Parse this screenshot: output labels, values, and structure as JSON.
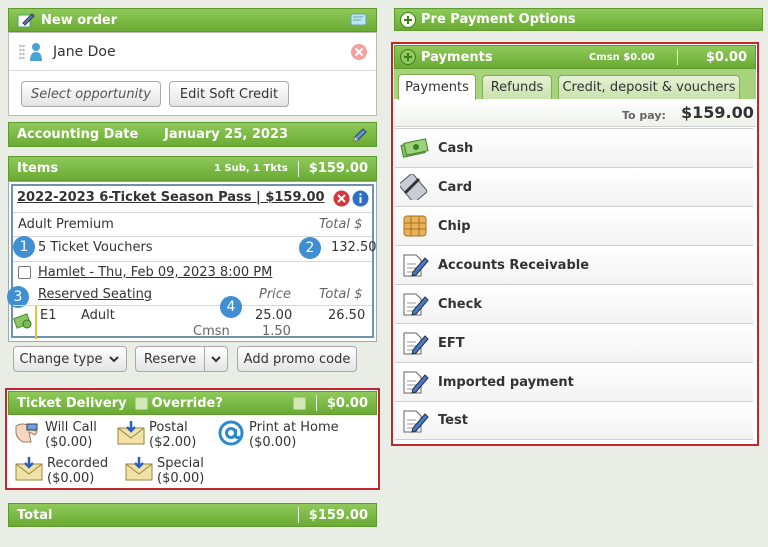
{
  "new_order": {
    "title": "New order",
    "customer_name": "Jane Doe",
    "select_opportunity": "Select opportunity",
    "edit_soft_credit": "Edit Soft Credit"
  },
  "accounting": {
    "label": "Accounting Date",
    "date": "January 25, 2023"
  },
  "items": {
    "title": "Items",
    "summary": "1 Sub, 1 Tkts",
    "total": "$159.00",
    "pass_title": "2022-2023 6-Ticket Season Pass | $159.00",
    "price_level": "Adult Premium",
    "total_header": "Total $",
    "vouchers_label": "5 Ticket Vouchers",
    "vouchers_total": "132.50",
    "performance": "Hamlet - Thu, Feb 09, 2023 8:00 PM",
    "seating": "Reserved Seating",
    "price_header": "Price",
    "total_header2": "Total $",
    "seat": "E1",
    "seat_type": "Adult",
    "seat_price": "25.00",
    "seat_total": "26.50",
    "cmsn_label": "Cmsn",
    "cmsn_value": "1.50",
    "markers": [
      "1",
      "2",
      "3",
      "4"
    ]
  },
  "item_buttons": {
    "change_type": "Change type",
    "reserve": "Reserve",
    "promo": "Add promo code"
  },
  "delivery": {
    "title": "Ticket Delivery",
    "override": "Override?",
    "amount": "$0.00",
    "options": [
      {
        "name": "Will Call",
        "price": "($0.00)",
        "icon": "hand-icon"
      },
      {
        "name": "Postal",
        "price": "($2.00)",
        "icon": "envelope-icon"
      },
      {
        "name": "Print at Home",
        "price": "($0.00)",
        "icon": "at-icon"
      },
      {
        "name": "Recorded",
        "price": "($0.00)",
        "icon": "envelope-icon"
      },
      {
        "name": "Special",
        "price": "($0.00)",
        "icon": "envelope-icon"
      }
    ]
  },
  "total_bar": {
    "label": "Total",
    "amount": "$159.00"
  },
  "pre_payment": {
    "title": "Pre Payment Options"
  },
  "payments": {
    "title": "Payments",
    "cmsn": "Cmsn $0.00",
    "amount": "$0.00",
    "tabs": [
      "Payments",
      "Refunds",
      "Credit, deposit & vouchers"
    ],
    "to_pay_label": "To pay:",
    "to_pay_amount": "$159.00",
    "methods": [
      "Cash",
      "Card",
      "Chip",
      "Accounts Receivable",
      "Check",
      "EFT",
      "Imported payment",
      "Test"
    ]
  },
  "colors": {
    "accent_green": "#6aab34",
    "highlight_red": "#c0282d",
    "info_blue": "#3f8fd2"
  }
}
